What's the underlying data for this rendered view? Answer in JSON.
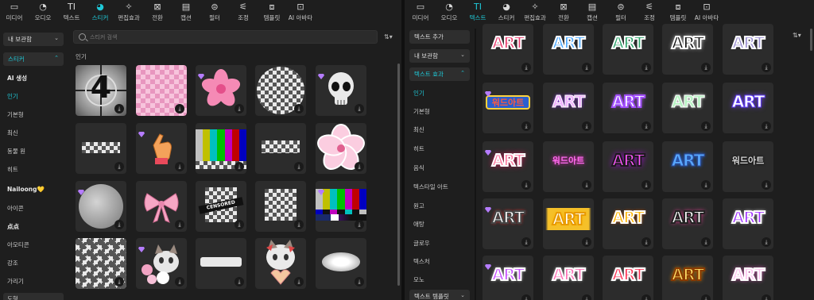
{
  "left": {
    "toolbar": [
      {
        "label": "미디어",
        "icon": "media-icon"
      },
      {
        "label": "오디오",
        "icon": "audio-icon"
      },
      {
        "label": "텍스트",
        "icon": "text-icon"
      },
      {
        "label": "스티커",
        "icon": "sticker-icon",
        "active": true
      },
      {
        "label": "편집효과",
        "icon": "effects-icon"
      },
      {
        "label": "전환",
        "icon": "transition-icon"
      },
      {
        "label": "캡션",
        "icon": "caption-icon"
      },
      {
        "label": "필터",
        "icon": "filter-icon"
      },
      {
        "label": "조정",
        "icon": "adjust-icon"
      },
      {
        "label": "템플릿",
        "icon": "template-icon"
      },
      {
        "label": "AI 아바타",
        "icon": "avatar-icon"
      }
    ],
    "sidebar": {
      "library_dropdown": "내 보관함",
      "sticker_dropdown": "스티커",
      "items": [
        "AI 생성",
        "인기",
        "기본형",
        "최신",
        "동물 원",
        "히트",
        "Nailoong💛",
        "아이콘",
        "点点",
        "아모티콘",
        "강조",
        "가리기",
        "도형"
      ]
    },
    "search_placeholder": "스티커 검색",
    "section_label": "인기",
    "accent": "#1fc9d8"
  },
  "right": {
    "toolbar": [
      {
        "label": "미디어",
        "icon": "media-icon"
      },
      {
        "label": "오디오",
        "icon": "audio-icon"
      },
      {
        "label": "텍스트",
        "icon": "text-icon",
        "active": true
      },
      {
        "label": "스티커",
        "icon": "sticker-icon"
      },
      {
        "label": "편집효과",
        "icon": "effects-icon"
      },
      {
        "label": "전환",
        "icon": "transition-icon"
      },
      {
        "label": "캡션",
        "icon": "caption-icon"
      },
      {
        "label": "필터",
        "icon": "filter-icon"
      },
      {
        "label": "조정",
        "icon": "adjust-icon"
      },
      {
        "label": "템플릿",
        "icon": "template-icon"
      },
      {
        "label": "AI 아바타",
        "icon": "avatar-icon"
      }
    ],
    "sidebar": {
      "add_text_button": "텍스트 추가",
      "library_dropdown": "내 보관함",
      "effects_dropdown": "텍스트 효과",
      "items": [
        "인기",
        "기본형",
        "최신",
        "히트",
        "음식",
        "텍스타일 아트",
        "원고",
        "애탕",
        "글로우",
        "텍스처",
        "모노"
      ],
      "template_dropdown": "텍스트 템플릿"
    },
    "art_word": "ART",
    "art_word_kr": "워드아트"
  }
}
